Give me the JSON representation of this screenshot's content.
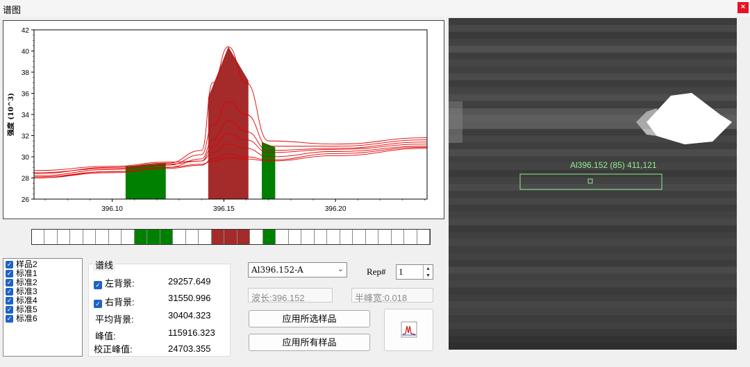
{
  "window": {
    "title": "谱图",
    "close_label": "×"
  },
  "chart_data": {
    "type": "line",
    "ylabel": "强度 (10^3)",
    "xlabel": "",
    "xlim": [
      396.065,
      396.241
    ],
    "ylim": [
      26,
      42
    ],
    "y_ticks": [
      26,
      28,
      30,
      32,
      34,
      36,
      38,
      40,
      42
    ],
    "x_ticks": [
      396.1,
      396.15,
      396.2
    ],
    "x_tick_labels": [
      "396.10",
      "396.15",
      "396.20"
    ],
    "regions": [
      {
        "name": "left-background",
        "color": "#008000",
        "x": [
          396.106,
          396.124
        ],
        "top": 29.4
      },
      {
        "name": "peak",
        "color": "#a52a2a",
        "x": [
          396.143,
          396.161
        ],
        "top": 40.4
      },
      {
        "name": "right-background",
        "color": "#008000",
        "x": [
          396.167,
          396.173
        ],
        "top": 31.4
      }
    ],
    "series": [
      {
        "x": [
          396.065,
          396.1,
          396.125,
          396.14,
          396.145,
          396.152,
          396.16,
          396.17,
          396.2,
          396.241
        ],
        "y": [
          28.4,
          29.0,
          29.4,
          30.6,
          37.0,
          40.4,
          37.0,
          31.5,
          31.2,
          31.8
        ]
      },
      {
        "x": [
          396.065,
          396.1,
          396.125,
          396.14,
          396.145,
          396.152,
          396.16,
          396.17,
          396.2,
          396.241
        ],
        "y": [
          28.2,
          28.8,
          29.2,
          30.2,
          33.0,
          35.2,
          34.0,
          31.0,
          31.0,
          31.6
        ]
      },
      {
        "x": [
          396.065,
          396.1,
          396.125,
          396.14,
          396.145,
          396.152,
          396.16,
          396.17,
          396.2,
          396.241
        ],
        "y": [
          28.0,
          28.6,
          29.0,
          29.8,
          31.6,
          33.4,
          32.4,
          30.6,
          30.8,
          31.4
        ]
      },
      {
        "x": [
          396.065,
          396.1,
          396.125,
          396.14,
          396.145,
          396.152,
          396.16,
          396.17,
          396.2,
          396.241
        ],
        "y": [
          28.5,
          28.9,
          29.3,
          29.6,
          31.0,
          32.2,
          31.6,
          30.4,
          30.7,
          31.2
        ]
      },
      {
        "x": [
          396.065,
          396.1,
          396.125,
          396.14,
          396.145,
          396.152,
          396.16,
          396.17,
          396.2,
          396.241
        ],
        "y": [
          28.7,
          29.1,
          29.5,
          29.6,
          30.4,
          31.2,
          30.8,
          30.0,
          30.5,
          31.0
        ]
      },
      {
        "x": [
          396.065,
          396.1,
          396.125,
          396.14,
          396.145,
          396.152,
          396.16,
          396.17,
          396.2,
          396.241
        ],
        "y": [
          28.0,
          28.5,
          28.9,
          29.2,
          29.8,
          30.3,
          30.0,
          29.7,
          30.3,
          30.9
        ]
      },
      {
        "x": [
          396.065,
          396.1,
          396.125,
          396.14,
          396.145,
          396.152,
          396.16,
          396.17,
          396.2,
          396.241
        ],
        "y": [
          28.1,
          28.6,
          29.0,
          29.3,
          29.6,
          29.9,
          29.8,
          29.6,
          30.1,
          30.8
        ]
      }
    ],
    "series_color": "#e00000",
    "grid": false
  },
  "strip": {
    "cells": 31,
    "green_cells": [
      8,
      9,
      10,
      18
    ],
    "red_cells": [
      14,
      15,
      16
    ],
    "green": "#008000",
    "red": "#a52a2a"
  },
  "samples": [
    {
      "label": "样品2",
      "checked": true
    },
    {
      "label": "标准1",
      "checked": true
    },
    {
      "label": "标准2",
      "checked": true
    },
    {
      "label": "标准3",
      "checked": true
    },
    {
      "label": "标准4",
      "checked": true
    },
    {
      "label": "标准5",
      "checked": true
    },
    {
      "label": "标准6",
      "checked": true
    }
  ],
  "lines": {
    "group_title": "谱线",
    "left_bg_label": "左背景:",
    "left_bg_value": "29257.649",
    "right_bg_label": "右背景:",
    "right_bg_value": "31550.996",
    "avg_bg_label": "平均背景:",
    "avg_bg_value": "30404.323",
    "peak_label": "峰值:",
    "peak_value": "115916.323",
    "corrected_label": "校正峰值:",
    "corrected_value": "24703.355"
  },
  "controls": {
    "line_select": "Al396.152-A",
    "rep_label": "Rep#",
    "rep_value": "1",
    "wavelength": "波长:396.152",
    "fwhm": "半峰宽:0.018",
    "apply_selected": "应用所选样品",
    "apply_all": "应用所有样品"
  },
  "image": {
    "roi_label": "Al396.152 (85) 411,121",
    "roi_color": "#90ee90"
  }
}
